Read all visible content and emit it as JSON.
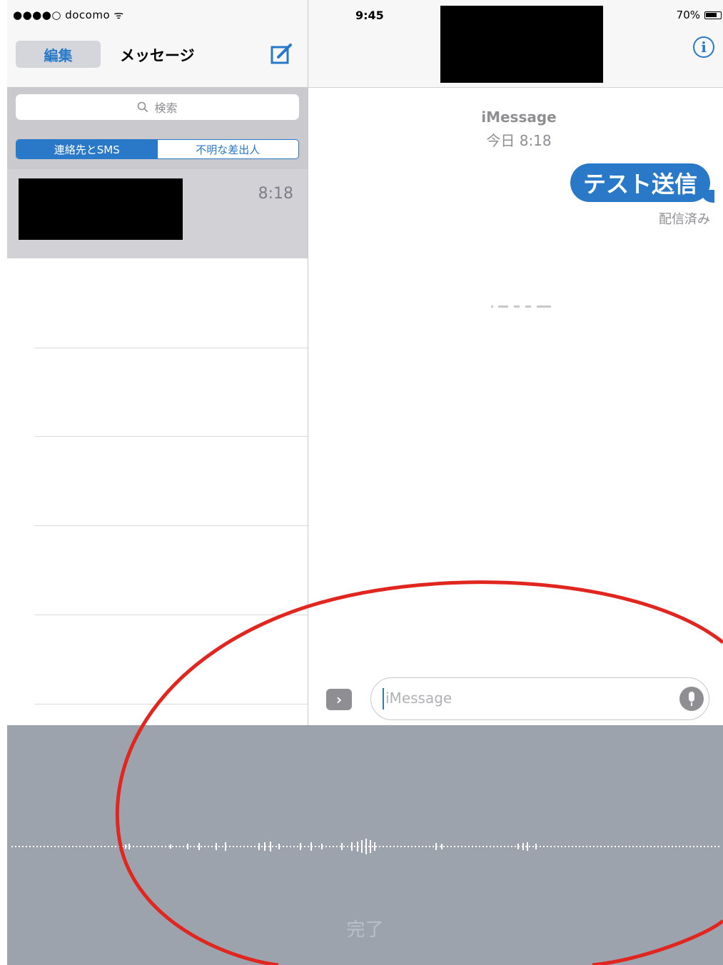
{
  "status_bar": {
    "carrier": "●●●●○ docomo ᯤ",
    "time": "9:45",
    "battery": "70%"
  },
  "left_panel": {
    "edit_label": "編集",
    "title": "メッセージ",
    "compose_icon": "compose-icon",
    "search_placeholder": "検索",
    "segments": [
      "連絡先とSMS",
      "不明な差出人"
    ],
    "active_segment": "連絡先とSMS",
    "conversations": [
      {
        "time": "8:18"
      }
    ]
  },
  "conversation": {
    "info_icon": "info-icon",
    "service_label": "iMessage",
    "timestamp": "今日 8:18",
    "messages": [
      {
        "text": "テスト送信",
        "from": "me",
        "status": "配信済み"
      }
    ],
    "input_placeholder": "iMessage",
    "expand_icon": "chevron-right-icon",
    "mic_icon": "microphone-icon"
  },
  "dictation": {
    "done_label": "完了"
  },
  "colors": {
    "accent": "#2a79c8",
    "dictation_bg": "#9ca3ad",
    "annotation": "#e0261f"
  }
}
